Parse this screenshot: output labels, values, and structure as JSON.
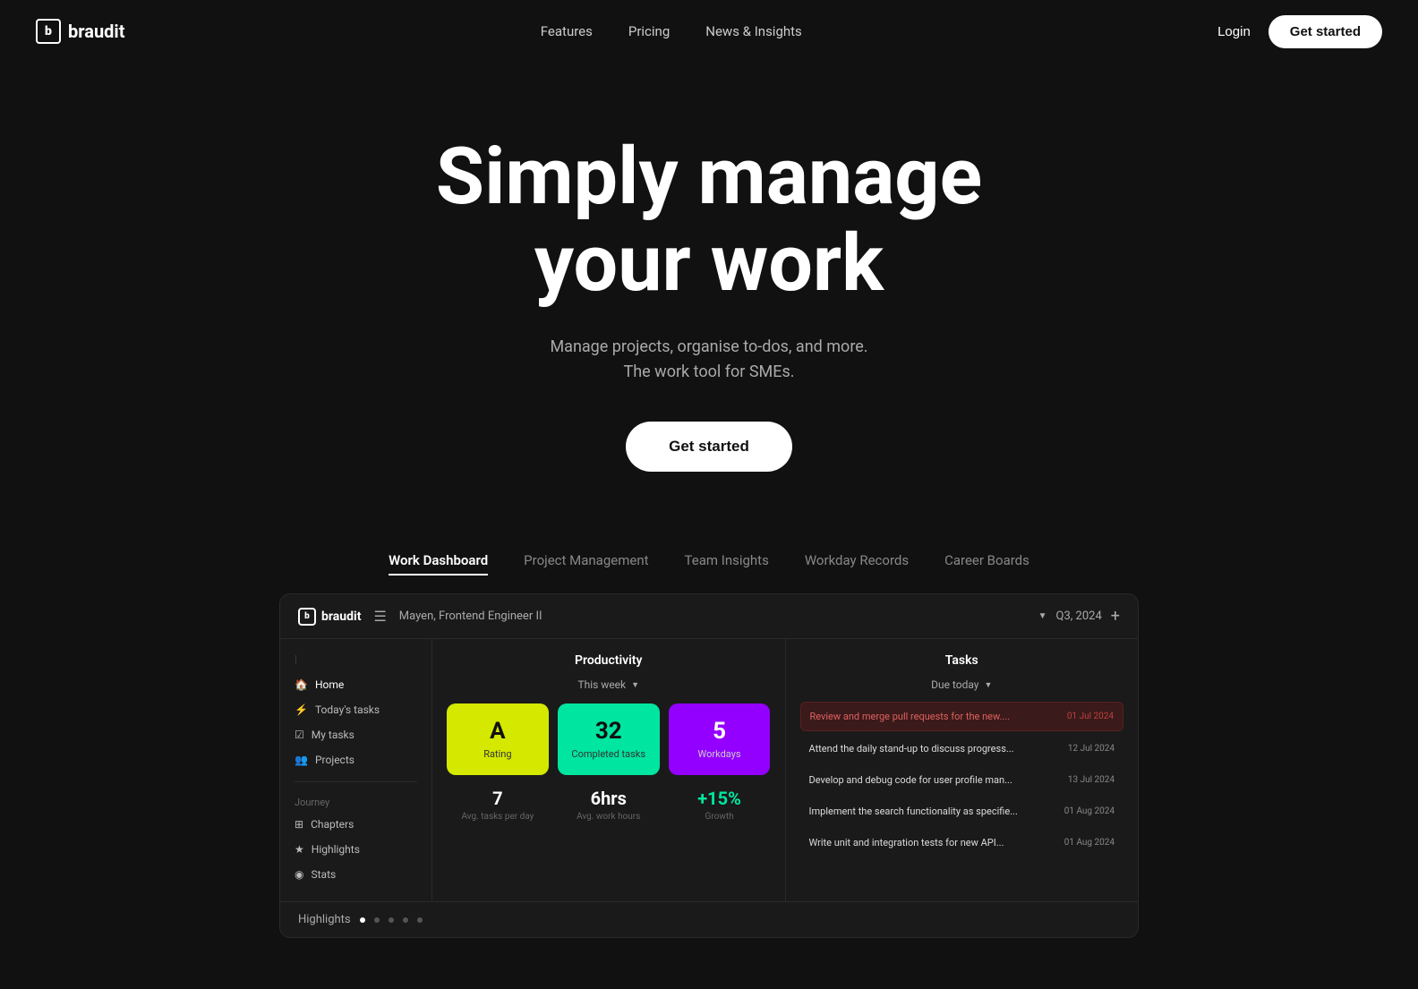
{
  "nav": {
    "logo_text": "braudit",
    "logo_icon": "b",
    "links": [
      {
        "label": "Features",
        "id": "features"
      },
      {
        "label": "Pricing",
        "id": "pricing"
      },
      {
        "label": "News & Insights",
        "id": "news"
      }
    ],
    "login_label": "Login",
    "get_started_label": "Get started"
  },
  "hero": {
    "headline_line1": "Simply manage",
    "headline_line2": "your work",
    "subtext_line1": "Manage projects, organise to-dos, and more.",
    "subtext_line2": "The work tool for SMEs.",
    "cta_label": "Get started"
  },
  "tabs": [
    {
      "label": "Work Dashboard",
      "active": true
    },
    {
      "label": "Project Management",
      "active": false
    },
    {
      "label": "Team Insights",
      "active": false
    },
    {
      "label": "Workday Records",
      "active": false
    },
    {
      "label": "Career Boards",
      "active": false
    }
  ],
  "dashboard": {
    "logo": "braudit",
    "user_name": "Mayen,",
    "user_role": "Frontend Engineer II",
    "period": "Q3, 2024",
    "sidebar": {
      "items": [
        {
          "label": "Home",
          "icon": "🏠",
          "active": true
        },
        {
          "label": "Today's tasks",
          "icon": "⚡"
        },
        {
          "label": "My tasks",
          "icon": "☑"
        },
        {
          "label": "Projects",
          "icon": "👥"
        }
      ],
      "section_label": "Journey",
      "journey_items": [
        {
          "label": "Chapters",
          "icon": "⊞"
        },
        {
          "label": "Highlights",
          "icon": "★"
        },
        {
          "label": "Stats",
          "icon": "◉"
        }
      ]
    },
    "productivity": {
      "title": "Productivity",
      "week_label": "This week",
      "cards": [
        {
          "value": "A",
          "label": "Rating",
          "color": "yellow"
        },
        {
          "value": "32",
          "label": "Completed tasks",
          "color": "green"
        },
        {
          "value": "5",
          "label": "Workdays",
          "color": "purple"
        }
      ],
      "stats": [
        {
          "value": "7",
          "label": "Avg. tasks per day",
          "color": "white"
        },
        {
          "value": "6hrs",
          "label": "Avg. work hours",
          "color": "white"
        },
        {
          "value": "+15%",
          "label": "Growth",
          "color": "green"
        }
      ]
    },
    "tasks": {
      "title": "Tasks",
      "due_label": "Due today",
      "items": [
        {
          "text": "Review and merge pull requests for the new....",
          "date": "01 Jul 2024",
          "highlighted": true
        },
        {
          "text": "Attend the daily stand-up to discuss progress...",
          "date": "12 Jul 2024",
          "highlighted": false
        },
        {
          "text": "Develop and debug code for user profile man...",
          "date": "13 Jul 2024",
          "highlighted": false
        },
        {
          "text": "Implement the search functionality as specifie...",
          "date": "01 Aug 2024",
          "highlighted": false
        },
        {
          "text": "Write unit and integration tests for new API...",
          "date": "01 Aug 2024",
          "highlighted": false
        }
      ]
    },
    "highlights_label": "Highlights",
    "highlights_dots": [
      {
        "active": true
      },
      {
        "active": false
      },
      {
        "active": false
      },
      {
        "active": false
      },
      {
        "active": false
      }
    ]
  }
}
